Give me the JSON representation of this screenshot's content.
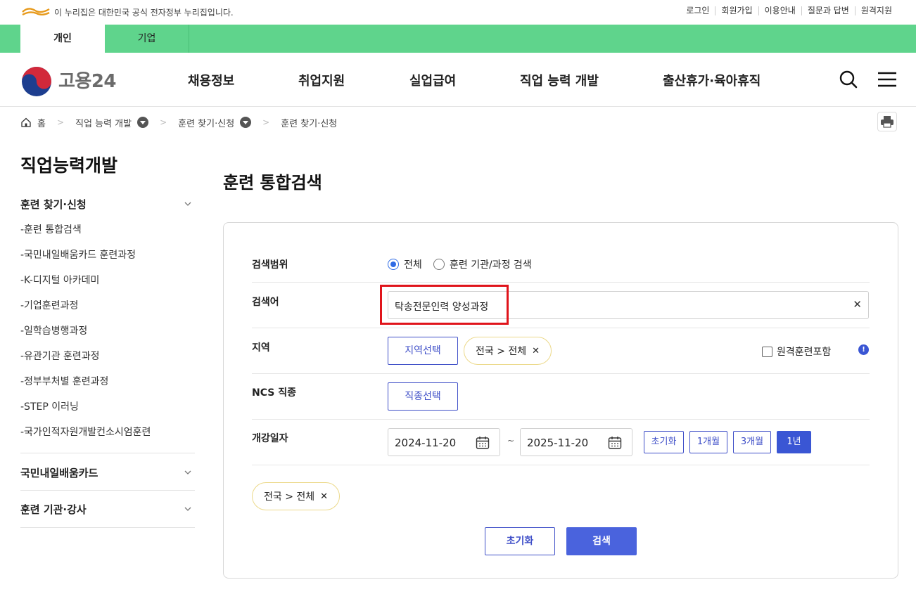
{
  "topbar": {
    "notice": "이 누리집은 대한민국 공식 전자정부 누리집입니다.",
    "links": [
      "로그인",
      "회원가입",
      "이용안내",
      "질문과 답변",
      "원격지원"
    ]
  },
  "audience_tabs": [
    "개인",
    "기업"
  ],
  "header": {
    "logo_text": "고용24",
    "nav": [
      "채용정보",
      "취업지원",
      "실업급여",
      "직업 능력 개발",
      "출산휴가·육아휴직"
    ]
  },
  "breadcrumb": [
    "홈",
    "직업 능력 개발",
    "훈련 찾기·신청",
    "훈련 찾기·신청"
  ],
  "sidebar": {
    "title": "직업능력개발",
    "group1": "훈련 찾기·신청",
    "items": [
      "-훈련 통합검색",
      "-국민내일배움카드 훈련과정",
      "-K-디지털 아카데미",
      "-기업훈련과정",
      "-일학습병행과정",
      "-유관기관 훈련과정",
      "-정부부처별 훈련과정",
      "-STEP 이러닝",
      "-국가인적자원개발컨소시엄훈련"
    ],
    "group2": "국민내일배움카드",
    "group3": "훈련 기관·강사"
  },
  "main": {
    "title": "훈련 통합검색",
    "scope_label": "검색범위",
    "scope_options": [
      "전체",
      "훈련 기관/과정 검색"
    ],
    "keyword_label": "검색어",
    "keyword_value": "탁송전문인력 양성과정",
    "clear_symbol": "✕",
    "region_label": "지역",
    "region_button": "지역선택",
    "region_chip": "전국 > 전체",
    "remote_label": "원격훈련포함",
    "ncs_label": "NCS 직종",
    "ncs_button": "직종선택",
    "date_label": "개강일자",
    "date_from": "2024-11-20",
    "date_to": "2025-11-20",
    "tilde": "~",
    "period_buttons": [
      "초기화",
      "1개월",
      "3개월",
      "1년"
    ],
    "summary_chip": "전국 > 전체",
    "reset_button": "초기화",
    "search_button": "검색"
  },
  "colors": {
    "green_bar": "#5fd48c",
    "primary": "#3a56d4",
    "highlight": "#e0141b"
  }
}
